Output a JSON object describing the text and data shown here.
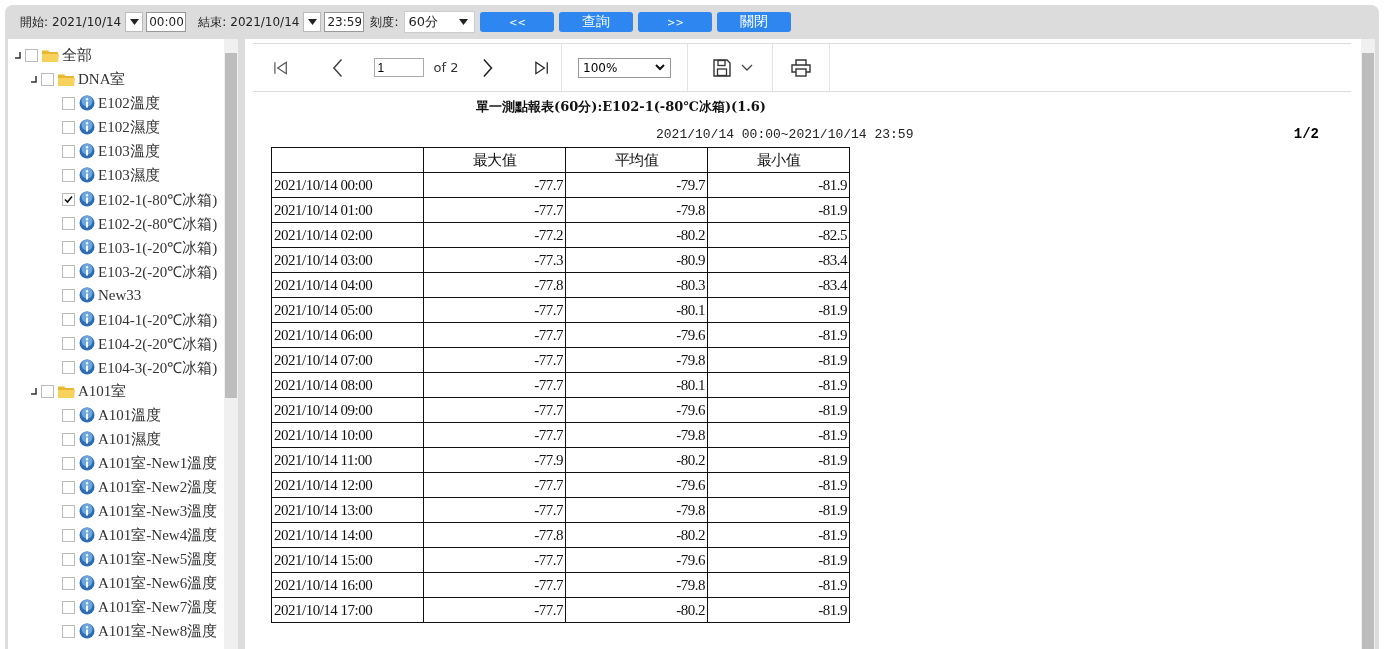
{
  "toolbar": {
    "start_label": "開始:",
    "start_date": "2021/10/14",
    "start_time": "00:00",
    "end_label": "結束:",
    "end_date": "2021/10/14",
    "end_time": "23:59",
    "scale_label": "刻度:",
    "scale_value": "60分",
    "buttons": [
      {
        "label": "<<",
        "kind": "prev"
      },
      {
        "label": "查詢",
        "kind": "query"
      },
      {
        "label": ">>",
        "kind": "next"
      },
      {
        "label": "關閉",
        "kind": "close"
      }
    ]
  },
  "tree": [
    {
      "label": "全部",
      "kind": "folder",
      "checked": false,
      "expanded": true,
      "children": [
        {
          "label": "DNA室",
          "kind": "folder",
          "checked": false,
          "expanded": true,
          "children": [
            {
              "label": "E102溫度",
              "kind": "sensor",
              "checked": false
            },
            {
              "label": "E102濕度",
              "kind": "sensor",
              "checked": false
            },
            {
              "label": "E103溫度",
              "kind": "sensor",
              "checked": false
            },
            {
              "label": "E103濕度",
              "kind": "sensor",
              "checked": false
            },
            {
              "label": "E102-1(-80℃冰箱)",
              "kind": "sensor",
              "checked": true
            },
            {
              "label": "E102-2(-80℃冰箱)",
              "kind": "sensor",
              "checked": false
            },
            {
              "label": "E103-1(-20℃冰箱)",
              "kind": "sensor",
              "checked": false
            },
            {
              "label": "E103-2(-20℃冰箱)",
              "kind": "sensor",
              "checked": false
            },
            {
              "label": "New33",
              "kind": "sensor",
              "checked": false
            },
            {
              "label": "E104-1(-20℃冰箱)",
              "kind": "sensor",
              "checked": false
            },
            {
              "label": "E104-2(-20℃冰箱)",
              "kind": "sensor",
              "checked": false
            },
            {
              "label": "E104-3(-20℃冰箱)",
              "kind": "sensor",
              "checked": false
            }
          ]
        },
        {
          "label": "A101室",
          "kind": "folder",
          "checked": false,
          "expanded": true,
          "children": [
            {
              "label": "A101溫度",
              "kind": "sensor",
              "checked": false
            },
            {
              "label": "A101濕度",
              "kind": "sensor",
              "checked": false
            },
            {
              "label": "A101室-New1溫度",
              "kind": "sensor",
              "checked": false
            },
            {
              "label": "A101室-New2溫度",
              "kind": "sensor",
              "checked": false
            },
            {
              "label": "A101室-New3溫度",
              "kind": "sensor",
              "checked": false
            },
            {
              "label": "A101室-New4溫度",
              "kind": "sensor",
              "checked": false
            },
            {
              "label": "A101室-New5溫度",
              "kind": "sensor",
              "checked": false
            },
            {
              "label": "A101室-New6溫度",
              "kind": "sensor",
              "checked": false
            },
            {
              "label": "A101室-New7溫度",
              "kind": "sensor",
              "checked": false
            },
            {
              "label": "A101室-New8溫度",
              "kind": "sensor",
              "checked": false
            }
          ]
        }
      ]
    }
  ],
  "viewer": {
    "page_input": "1",
    "page_of": "of 2",
    "zoom": "100%"
  },
  "report": {
    "title": "單一測點報表(60分):E102-1(-80℃冰箱)(1.6)",
    "range": "2021/10/14 00:00~2021/10/14 23:59",
    "page": "1/2",
    "columns": [
      "",
      "最大值",
      "平均值",
      "最小值"
    ],
    "rows": [
      [
        "2021/10/14 00:00",
        "-77.7",
        "-79.7",
        "-81.9"
      ],
      [
        "2021/10/14 01:00",
        "-77.7",
        "-79.8",
        "-81.9"
      ],
      [
        "2021/10/14 02:00",
        "-77.2",
        "-80.2",
        "-82.5"
      ],
      [
        "2021/10/14 03:00",
        "-77.3",
        "-80.9",
        "-83.4"
      ],
      [
        "2021/10/14 04:00",
        "-77.8",
        "-80.3",
        "-83.4"
      ],
      [
        "2021/10/14 05:00",
        "-77.7",
        "-80.1",
        "-81.9"
      ],
      [
        "2021/10/14 06:00",
        "-77.7",
        "-79.6",
        "-81.9"
      ],
      [
        "2021/10/14 07:00",
        "-77.7",
        "-79.8",
        "-81.9"
      ],
      [
        "2021/10/14 08:00",
        "-77.7",
        "-80.1",
        "-81.9"
      ],
      [
        "2021/10/14 09:00",
        "-77.7",
        "-79.6",
        "-81.9"
      ],
      [
        "2021/10/14 10:00",
        "-77.7",
        "-79.8",
        "-81.9"
      ],
      [
        "2021/10/14 11:00",
        "-77.9",
        "-80.2",
        "-81.9"
      ],
      [
        "2021/10/14 12:00",
        "-77.7",
        "-79.6",
        "-81.9"
      ],
      [
        "2021/10/14 13:00",
        "-77.7",
        "-79.8",
        "-81.9"
      ],
      [
        "2021/10/14 14:00",
        "-77.8",
        "-80.2",
        "-81.9"
      ],
      [
        "2021/10/14 15:00",
        "-77.7",
        "-79.6",
        "-81.9"
      ],
      [
        "2021/10/14 16:00",
        "-77.7",
        "-79.8",
        "-81.9"
      ],
      [
        "2021/10/14 17:00",
        "-77.7",
        "-80.2",
        "-81.9"
      ]
    ]
  }
}
